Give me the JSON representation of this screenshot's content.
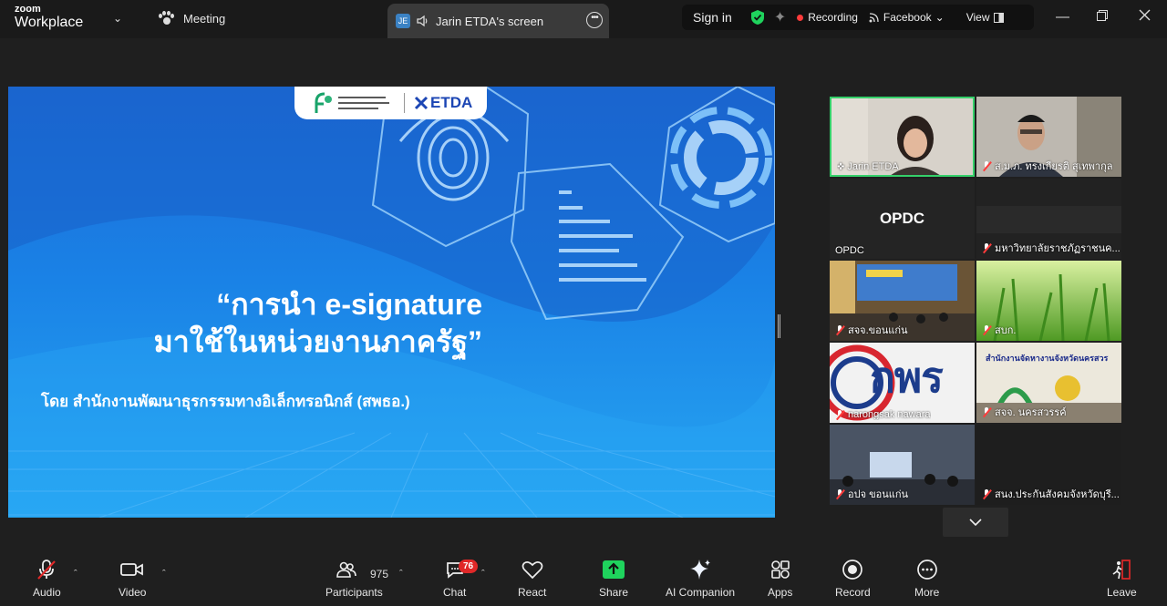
{
  "app": {
    "brand_top": "zoom",
    "brand_bottom": "Workplace"
  },
  "titlebar": {
    "meeting_label": "Meeting",
    "screen_tab": {
      "initials": "JE",
      "label": "Jarin ETDA's screen"
    },
    "sign_in": "Sign in",
    "recording": "Recording",
    "live": "Facebook",
    "view": "View"
  },
  "slide": {
    "logo_left_text": "ก",
    "logo_brand": "ETDA",
    "title_line1": "“การนำ e-signature",
    "title_line2": "มาใช้ในหน่วยงานภาครัฐ”",
    "subtitle": "โดย สำนักงานพัฒนาธุรกรรมทางอิเล็กทรอนิกส์ (สพธอ.)"
  },
  "participants": [
    {
      "name": "Jarin ETDA",
      "pinned": true,
      "muted": false
    },
    {
      "name": "ส.ม.ภ. ทรงเกียรติ สุเทพากุล",
      "muted": true
    },
    {
      "name": "OPDC",
      "label": "OPDC",
      "muted": false
    },
    {
      "name": "มหาวิทยาลัยราชภัฏราชนค...",
      "muted": true
    },
    {
      "name": "สจจ.ขอนแก่น",
      "muted": true
    },
    {
      "name": "สบก.",
      "muted": true
    },
    {
      "name": "narongsak nawara",
      "muted": true,
      "logo_text": "กพร"
    },
    {
      "name": "สจจ. นครสวรรค์",
      "muted": true,
      "banner": "สำนักงานจัดหางานจังหวัดนครสวร"
    },
    {
      "name": "อปจ ขอนแก่น",
      "muted": true
    },
    {
      "name": "สนง.ประกันสังคมจังหวัดบุรี...",
      "muted": true
    }
  ],
  "toolbar": {
    "audio": "Audio",
    "video": "Video",
    "participants": "Participants",
    "participants_count": "975",
    "chat": "Chat",
    "chat_badge": "76",
    "react": "React",
    "share": "Share",
    "ai_companion": "AI Companion",
    "apps": "Apps",
    "record": "Record",
    "more": "More",
    "leave": "Leave"
  },
  "colors": {
    "share_green": "#1fd35d",
    "recording_red": "#ff3b3b",
    "shield_green": "#1fd35d"
  }
}
